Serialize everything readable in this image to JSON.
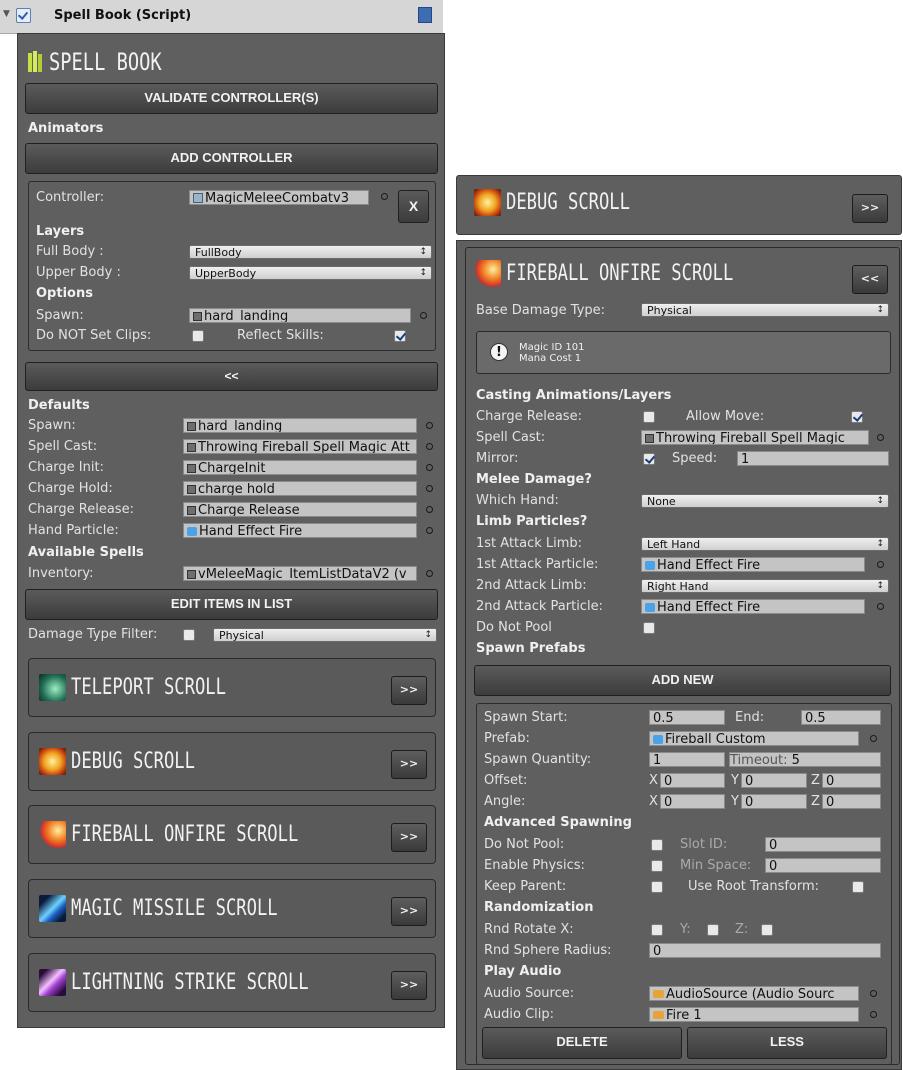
{
  "component": {
    "title": "Spell Book (Script)"
  },
  "spellbook": {
    "title": "SPELL BOOK",
    "validate_label": "VALIDATE CONTROLLER(S)",
    "animators_header": "Animators",
    "add_controller_label": "ADD CONTROLLER",
    "controller": {
      "label": "Controller:",
      "value": "MagicMeleeCombatv3",
      "remove_label": "X",
      "layers_header": "Layers",
      "full_body_label": "Full Body :",
      "full_body_value": "FullBody",
      "upper_body_label": "Upper Body :",
      "upper_body_value": "UpperBody",
      "options_header": "Options",
      "spawn_label": "Spawn:",
      "spawn_value": "hard_landing",
      "do_not_set_clips_label": "Do NOT Set Clips:",
      "reflect_skills_label": "Reflect Skills:"
    },
    "collapse_label": "<<",
    "defaults": {
      "header": "Defaults",
      "rows": [
        {
          "label": "Spawn:",
          "value": "hard_landing"
        },
        {
          "label": "Spell Cast:",
          "value": "Throwing Fireball Spell Magic Att"
        },
        {
          "label": "Charge Init:",
          "value": "ChargeInit"
        },
        {
          "label": "Charge Hold:",
          "value": "charge hold"
        },
        {
          "label": "Charge Release:",
          "value": "Charge Release"
        },
        {
          "label": "Hand Particle:",
          "value": "Hand Effect Fire"
        }
      ]
    },
    "available_spells_header": "Available Spells",
    "inventory_label": "Inventory:",
    "inventory_value": "vMeleeMagic_ItemListDataV2 (v",
    "edit_items_label": "EDIT ITEMS IN LIST",
    "damage_filter_label": "Damage Type Filter:",
    "damage_filter_value": "Physical",
    "scrolls": [
      {
        "name": "TELEPORT SCROLL",
        "button": ">>",
        "color": "#2e8a6e"
      },
      {
        "name": "DEBUG SCROLL",
        "button": ">>",
        "color": "#e88a1a"
      },
      {
        "name": "FIREBALL ONFIRE SCROLL",
        "button": ">>",
        "color": "#e5502a"
      },
      {
        "name": "MAGIC MISSILE SCROLL",
        "button": ">>",
        "color": "#2f7be0"
      },
      {
        "name": "LIGHTNING STRIKE SCROLL",
        "button": ">>",
        "color": "#b04ad8"
      }
    ]
  },
  "detail": {
    "debug_title": "DEBUG SCROLL",
    "debug_button": ">>",
    "fireball_title": "FIREBALL ONFIRE SCROLL",
    "fireball_button": "<<",
    "base_damage_label": "Base Damage Type:",
    "base_damage_value": "Physical",
    "info_line1": "Magic ID  101",
    "info_line2": "Mana Cost 1",
    "casting_header": "Casting Animations/Layers",
    "charge_release_label": "Charge Release:",
    "allow_move_label": "Allow Move:",
    "spell_cast_label": "Spell Cast:",
    "spell_cast_value": "Throwing Fireball Spell Magic",
    "mirror_label": "Mirror:",
    "speed_label": "Speed:",
    "speed_value": "1",
    "melee_header": "Melee Damage?",
    "which_hand_label": "Which Hand:",
    "which_hand_value": "None",
    "limb_header": "Limb Particles?",
    "limb_rows": [
      {
        "label": "1st Attack Limb:",
        "value": "Left Hand",
        "kind": "popup"
      },
      {
        "label": "1st Attack Particle:",
        "value": "Hand Effect Fire",
        "kind": "object"
      },
      {
        "label": "2nd Attack Limb:",
        "value": "Right Hand",
        "kind": "popup"
      },
      {
        "label": "2nd Attack Particle:",
        "value": "Hand Effect Fire",
        "kind": "object"
      }
    ],
    "do_not_pool_label": "Do Not Pool",
    "spawn_prefabs_header": "Spawn Prefabs",
    "add_new_label": "ADD NEW",
    "spawn": {
      "start_label": "Spawn Start:",
      "start_value": "0.5",
      "end_label": "End:",
      "end_value": "0.5",
      "prefab_label": "Prefab:",
      "prefab_value": "Fireball Custom",
      "quantity_label": "Spawn Quantity:",
      "quantity_value": "1",
      "timeout_label": "Timeout:",
      "timeout_value": "5",
      "offset_label": "Offset:",
      "offset": {
        "x": "0",
        "y": "0",
        "z": "0"
      },
      "angle_label": "Angle:",
      "angle": {
        "x": "0",
        "y": "0",
        "z": "0"
      },
      "axis_x": "X",
      "axis_y": "Y",
      "axis_z": "Z",
      "advanced_header": "Advanced Spawning",
      "do_not_pool_label": "Do Not Pool:",
      "slot_id_label": "Slot ID:",
      "slot_id_value": "0",
      "enable_physics_label": "Enable Physics:",
      "min_space_label": "Min Space:",
      "min_space_value": "0",
      "keep_parent_label": "Keep Parent:",
      "use_root_label": "Use Root Transform:",
      "random_header": "Randomization",
      "rnd_rotate_label": "Rnd Rotate X:",
      "rnd_y_label": "Y:",
      "rnd_z_label": "Z:",
      "rnd_sphere_label": "Rnd Sphere Radius:",
      "rnd_sphere_value": "0",
      "audio_header": "Play Audio",
      "audio_source_label": "Audio Source:",
      "audio_source_value": "AudioSource (Audio Sourc",
      "audio_clip_label": "Audio Clip:",
      "audio_clip_value": "Fire 1",
      "delete_label": "DELETE",
      "less_label": "LESS"
    }
  }
}
